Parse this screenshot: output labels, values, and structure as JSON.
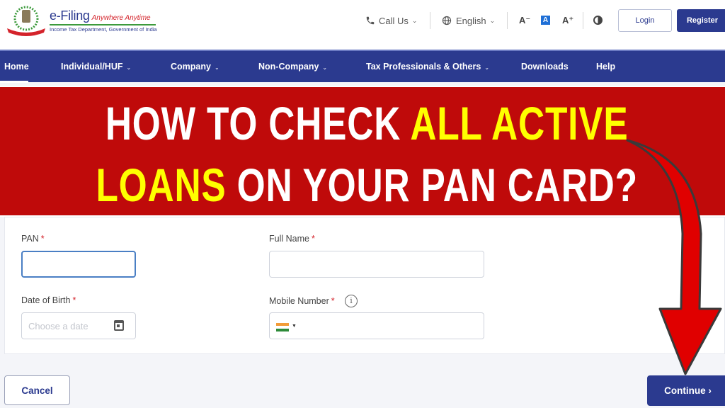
{
  "header": {
    "brand_title": "e-Filing",
    "brand_tagline": "Anywhere Anytime",
    "brand_subtitle": "Income Tax Department, Government of India",
    "call_us": "Call Us",
    "language": "English",
    "font_decrease": "A⁻",
    "font_default": "A",
    "font_increase": "A⁺",
    "login_label": "Login",
    "register_label": "Register"
  },
  "nav": {
    "items": [
      {
        "label": "Home",
        "active": true,
        "dropdown": false
      },
      {
        "label": "Individual/HUF",
        "dropdown": true
      },
      {
        "label": "Company",
        "dropdown": true
      },
      {
        "label": "Non-Company",
        "dropdown": true
      },
      {
        "label": "Tax Professionals & Others",
        "dropdown": true
      },
      {
        "label": "Downloads",
        "dropdown": false
      },
      {
        "label": "Help",
        "dropdown": false
      }
    ]
  },
  "banner": {
    "line1_white": "HOW TO CHECK ",
    "line1_yellow": "ALL ACTIVE",
    "line2_yellow": "LOANS",
    "line2_white": " ON YOUR PAN CARD?",
    "bg_color": "#bf0a0a",
    "highlight_color": "#ffff00"
  },
  "form": {
    "pan_label": "PAN",
    "pan_value": "",
    "full_name_label": "Full Name",
    "full_name_value": "",
    "dob_label": "Date of Birth",
    "dob_placeholder": "Choose a date",
    "mobile_label": "Mobile Number",
    "mobile_value": "",
    "mobile_country": "India",
    "required_mark": "*",
    "info_glyph": "i"
  },
  "actions": {
    "cancel_label": "Cancel",
    "continue_label": "Continue ›"
  },
  "colors": {
    "primary": "#2b3a8f",
    "required": "#d4232b"
  }
}
